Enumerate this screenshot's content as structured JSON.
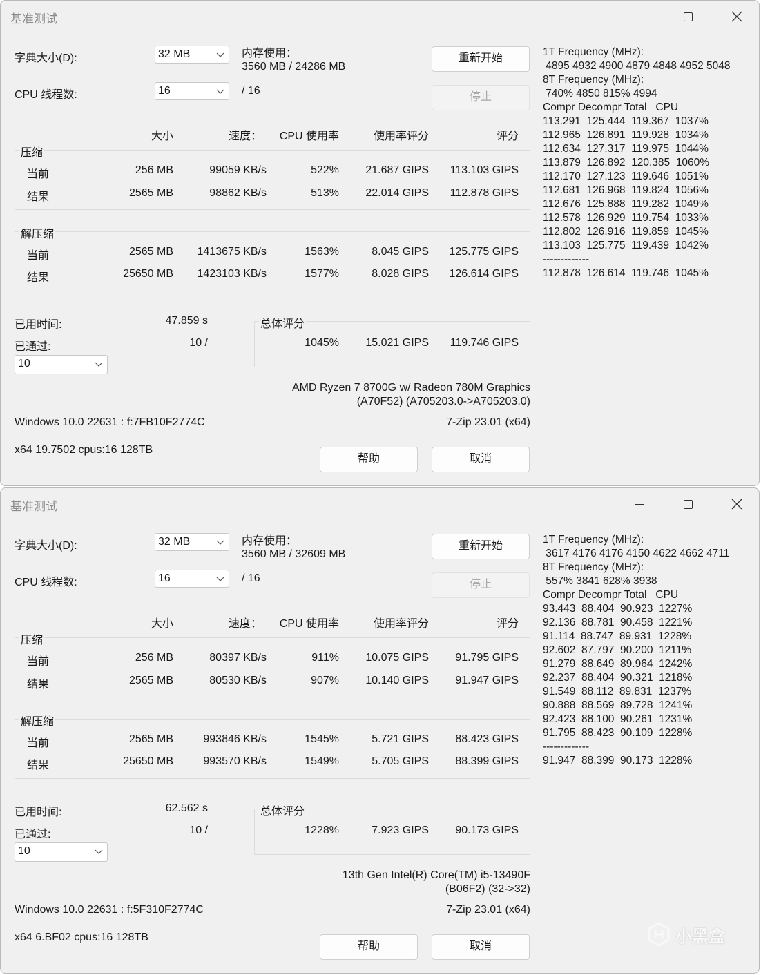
{
  "windows": [
    {
      "title": "基准测试",
      "dict_label": "字典大小(D):",
      "dict_value": "32 MB",
      "threads_label": "CPU 线程数:",
      "threads_value": "16",
      "threads_total": "/ 16",
      "mem_label": "内存使用：",
      "mem_value": "3560 MB / 24286 MB",
      "restart_button": "重新开始",
      "stop_button": "停止",
      "headers": {
        "size": "大小",
        "speed": "速度：",
        "cpu": "CPU 使用率",
        "rating_usage": "使用率评分",
        "rating": "评分"
      },
      "compress": {
        "label": "压缩",
        "rows": [
          {
            "label": "当前",
            "size": "256 MB",
            "speed": "99059 KB/s",
            "cpu": "522%",
            "usage": "21.687 GIPS",
            "rating": "113.103 GIPS"
          },
          {
            "label": "结果",
            "size": "2565 MB",
            "speed": "98862 KB/s",
            "cpu": "513%",
            "usage": "22.014 GIPS",
            "rating": "112.878 GIPS"
          }
        ]
      },
      "decompress": {
        "label": "解压缩",
        "rows": [
          {
            "label": "当前",
            "size": "2565 MB",
            "speed": "1413675 KB/s",
            "cpu": "1563%",
            "usage": "8.045 GIPS",
            "rating": "125.775 GIPS"
          },
          {
            "label": "结果",
            "size": "25650 MB",
            "speed": "1423103 KB/s",
            "cpu": "1577%",
            "usage": "8.028 GIPS",
            "rating": "126.614 GIPS"
          }
        ]
      },
      "elapsed_label": "已用时间:",
      "elapsed_value": "47.859 s",
      "passed_label": "已通过:",
      "passed_value": "10 /",
      "passes_select": "10",
      "total": {
        "label": "总体评分",
        "cpu": "1045%",
        "usage": "15.021 GIPS",
        "rating": "119.746 GIPS"
      },
      "cpu_name_1": "AMD Ryzen 7 8700G w/ Radeon 780M Graphics",
      "cpu_name_2": "(A70F52) (A705203.0->A705203.0)",
      "os_info": "Windows 10.0 22631 :  f:7FB10F2774C",
      "version": "7-Zip 23.01 (x64)",
      "sys_info": "x64 19.7502 cpus:16 128TB",
      "help_button": "帮助",
      "cancel_button": "取消",
      "log": "1T Frequency (MHz):\n 4895 4932 4900 4879 4848 4952 5048\n8T Frequency (MHz):\n 740% 4850 815% 4994\nCompr Decompr Total   CPU\n113.291  125.444  119.367  1037%\n112.965  126.891  119.928  1034%\n112.634  127.317  119.975  1044%\n113.879  126.892  120.385  1060%\n112.170  127.123  119.646  1051%\n112.681  126.968  119.824  1056%\n112.676  125.888  119.282  1049%\n112.578  126.929  119.754  1033%\n112.802  126.916  119.859  1045%\n113.103  125.775  119.439  1042%\n-------------\n112.878  126.614  119.746  1045%"
    },
    {
      "title": "基准测试",
      "dict_label": "字典大小(D):",
      "dict_value": "32 MB",
      "threads_label": "CPU 线程数:",
      "threads_value": "16",
      "threads_total": "/ 16",
      "mem_label": "内存使用：",
      "mem_value": "3560 MB / 32609 MB",
      "restart_button": "重新开始",
      "stop_button": "停止",
      "headers": {
        "size": "大小",
        "speed": "速度：",
        "cpu": "CPU 使用率",
        "rating_usage": "使用率评分",
        "rating": "评分"
      },
      "compress": {
        "label": "压缩",
        "rows": [
          {
            "label": "当前",
            "size": "256 MB",
            "speed": "80397 KB/s",
            "cpu": "911%",
            "usage": "10.075 GIPS",
            "rating": "91.795 GIPS"
          },
          {
            "label": "结果",
            "size": "2565 MB",
            "speed": "80530 KB/s",
            "cpu": "907%",
            "usage": "10.140 GIPS",
            "rating": "91.947 GIPS"
          }
        ]
      },
      "decompress": {
        "label": "解压缩",
        "rows": [
          {
            "label": "当前",
            "size": "2565 MB",
            "speed": "993846 KB/s",
            "cpu": "1545%",
            "usage": "5.721 GIPS",
            "rating": "88.423 GIPS"
          },
          {
            "label": "结果",
            "size": "25650 MB",
            "speed": "993570 KB/s",
            "cpu": "1549%",
            "usage": "5.705 GIPS",
            "rating": "88.399 GIPS"
          }
        ]
      },
      "elapsed_label": "已用时间:",
      "elapsed_value": "62.562 s",
      "passed_label": "已通过:",
      "passed_value": "10 /",
      "passes_select": "10",
      "total": {
        "label": "总体评分",
        "cpu": "1228%",
        "usage": "7.923 GIPS",
        "rating": "90.173 GIPS"
      },
      "cpu_name_1": "13th Gen Intel(R) Core(TM) i5-13490F",
      "cpu_name_2": "(B06F2) (32->32)",
      "os_info": "Windows 10.0 22631 :  f:5F310F2774C",
      "version": "7-Zip 23.01 (x64)",
      "sys_info": "x64 6.BF02 cpus:16 128TB",
      "help_button": "帮助",
      "cancel_button": "取消",
      "log": "1T Frequency (MHz):\n 3617 4176 4176 4150 4622 4662 4711\n8T Frequency (MHz):\n 557% 3841 628% 3938\nCompr Decompr Total   CPU\n93.443  88.404  90.923  1227%\n92.136  88.781  90.458  1221%\n91.114  88.747  89.931  1228%\n92.602  87.797  90.200  1211%\n91.279  88.649  89.964  1242%\n92.237  88.404  90.321  1218%\n91.549  88.112  89.831  1237%\n90.888  88.569  89.728  1241%\n92.423  88.100  90.261  1231%\n91.795  88.423  90.109  1228%\n-------------\n91.947  88.399  90.173  1228%"
    }
  ],
  "watermark": "小黑盒"
}
